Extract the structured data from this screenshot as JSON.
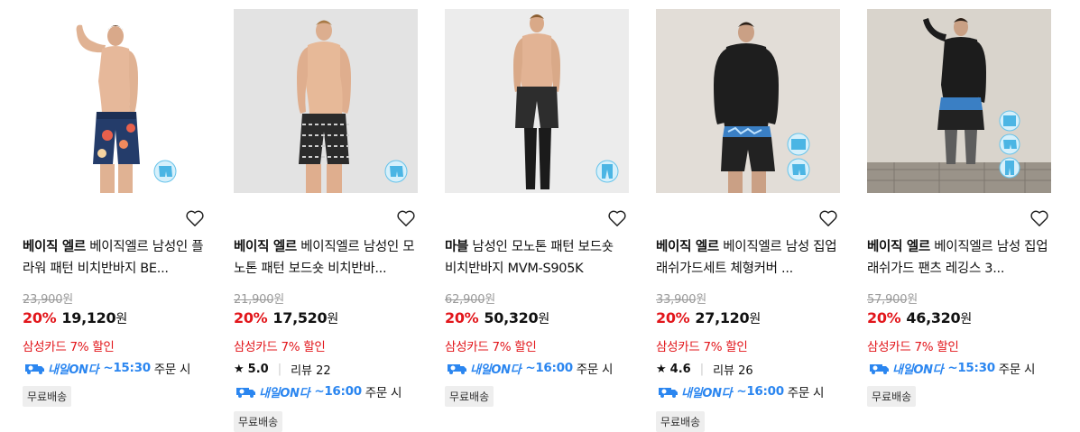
{
  "products": [
    {
      "brand": "베이직 엘르",
      "name": "베이직엘르 남성인 플라워 패턴 비치반바지 BE...",
      "original_price": "23,900",
      "original_unit": "원",
      "discount": "20%",
      "price": "19,120",
      "price_unit": "원",
      "promo": "삼성카드 7% 할인",
      "delivery_badge": "내일ON다",
      "delivery_time": "~15:30",
      "delivery_suffix": "주문 시",
      "free_shipping": "무료배송",
      "wish_icon": "heart-outline-icon"
    },
    {
      "brand": "베이직 엘르",
      "name": "베이직엘르 남성인 모노톤 패턴 보드숏 비치반바...",
      "original_price": "21,900",
      "original_unit": "원",
      "discount": "20%",
      "price": "17,520",
      "price_unit": "원",
      "promo": "삼성카드 7% 할인",
      "rating": "5.0",
      "review_label": "리뷰 22",
      "delivery_badge": "내일ON다",
      "delivery_time": "~16:00",
      "delivery_suffix": "주문 시",
      "free_shipping": "무료배송",
      "wish_icon": "heart-outline-icon"
    },
    {
      "brand": "마블",
      "name": "남성인 모노톤 패턴 보드숏 비치반바지 MVM-S905K",
      "original_price": "62,900",
      "original_unit": "원",
      "discount": "20%",
      "price": "50,320",
      "price_unit": "원",
      "promo": "삼성카드 7% 할인",
      "delivery_badge": "내일ON다",
      "delivery_time": "~16:00",
      "delivery_suffix": "주문 시",
      "free_shipping": "무료배송",
      "wish_icon": "heart-outline-icon"
    },
    {
      "brand": "베이직 엘르",
      "name": "베이직엘르 남성 집업래쉬가드세트 체형커버 ...",
      "original_price": "33,900",
      "original_unit": "원",
      "discount": "20%",
      "price": "27,120",
      "price_unit": "원",
      "promo": "삼성카드 7% 할인",
      "rating": "4.6",
      "review_label": "리뷰 26",
      "delivery_badge": "내일ON다",
      "delivery_time": "~16:00",
      "delivery_suffix": "주문 시",
      "free_shipping": "무료배송",
      "wish_icon": "heart-outline-icon"
    },
    {
      "brand": "베이직 엘르",
      "name": "베이직엘르 남성 집업래쉬가드 팬츠 레깅스 3...",
      "original_price": "57,900",
      "original_unit": "원",
      "discount": "20%",
      "price": "46,320",
      "price_unit": "원",
      "promo": "삼성카드 7% 할인",
      "delivery_badge": "내일ON다",
      "delivery_time": "~15:30",
      "delivery_suffix": "주문 시",
      "free_shipping": "무료배송",
      "wish_icon": "heart-outline-icon"
    }
  ],
  "colors": {
    "discount_red": "#e2161b",
    "delivery_blue": "#2b86f0",
    "strike_gray": "#9a9a9a",
    "badge_bg": "#eeeeee"
  }
}
